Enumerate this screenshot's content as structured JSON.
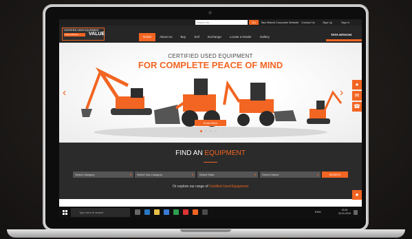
{
  "utility_bar": {
    "search_placeholder": "Search for",
    "go_label": "Go",
    "links": [
      "Tata Hitachi Corporate Website",
      "Contact Us",
      "Sign Up",
      "Sign In"
    ]
  },
  "header": {
    "logo_line1": "CERTIFIED USED EQUIPMENT",
    "logo_line2": "TATA HITACHI",
    "logo_mark": "VALUE",
    "nav": [
      "Home",
      "About Us",
      "Buy",
      "Sell",
      "Exchange",
      "Locate a Dealer",
      "Gallery"
    ],
    "active_nav": "Home",
    "brand": "TATA HITACHI",
    "accent_color": "#f26522"
  },
  "hero": {
    "tagline": "CERTIFIED USED EQUIPMENT",
    "headline": "FOR COMPLETE PEACE OF MIND",
    "button": "Know More",
    "prev_arrow": "‹",
    "next_arrow": "›",
    "slide_count": 4,
    "active_slide": 1,
    "side_icons": [
      "location-pin-icon",
      "mail-icon",
      "phone-icon"
    ]
  },
  "find": {
    "title_prefix": "FIND AN ",
    "title_highlight": "EQUIPMENT",
    "selects": [
      "Select Category",
      "Select Sub-Category",
      "Select State",
      "Select District"
    ],
    "search_button": "SEARCH",
    "explore_prefix": "Or explore our range of ",
    "explore_link": "Certified Used Equipment"
  },
  "taskbar": {
    "search_placeholder": "Type here to search",
    "time": "15:26",
    "date": "02-01-2019",
    "lang": "ENG"
  }
}
